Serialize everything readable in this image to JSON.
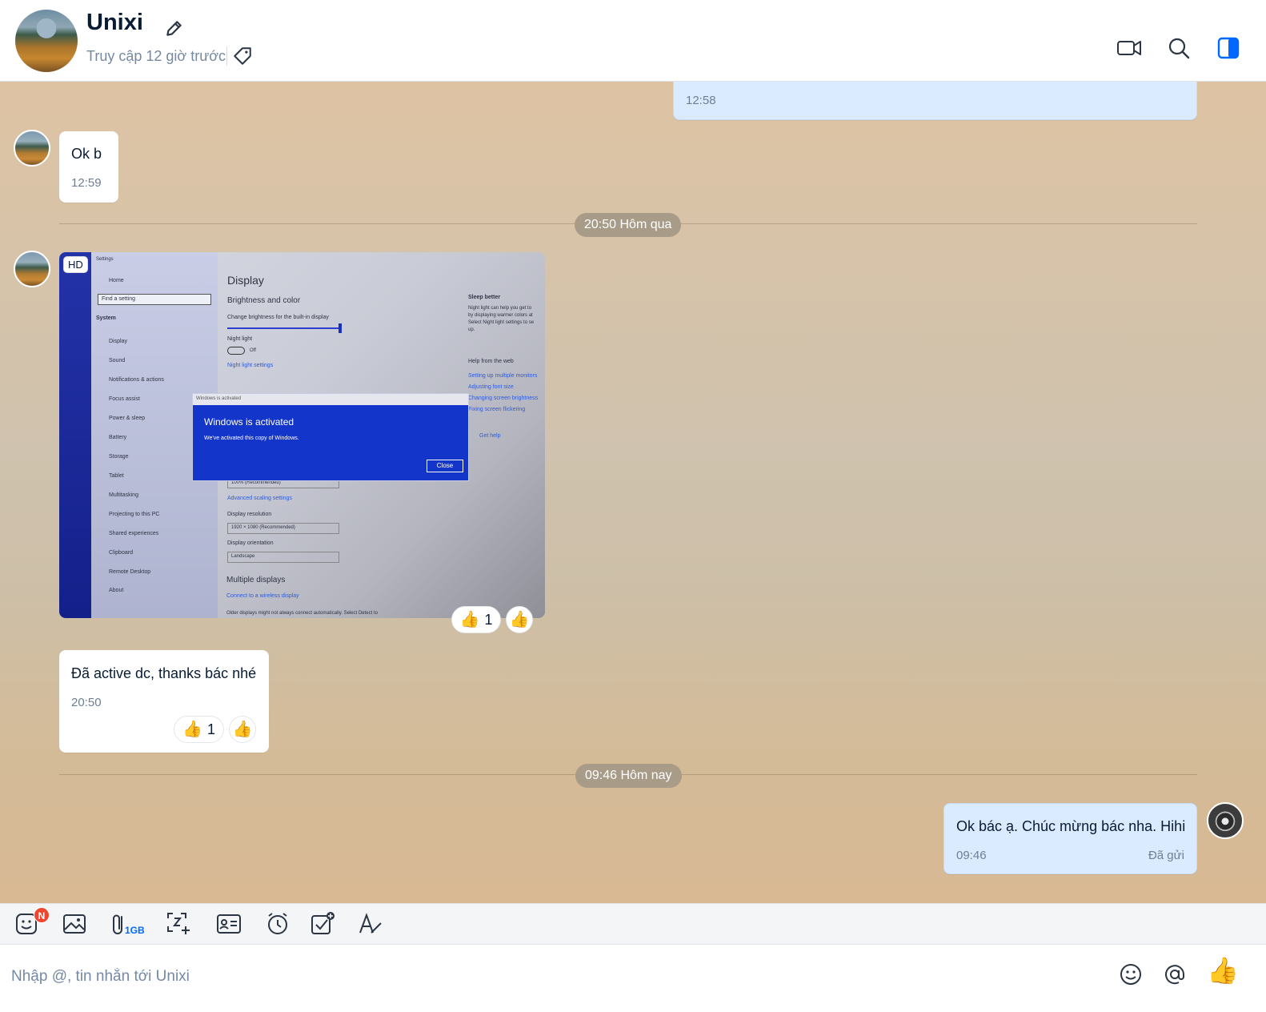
{
  "header": {
    "name": "Unixi",
    "status": "Truy cập 12 giờ trước"
  },
  "messages": {
    "top_partial_time": "12:58",
    "ok_b": {
      "text": "Ok b",
      "time": "12:59"
    },
    "date_divider_1": "20:50 Hôm qua",
    "image": {
      "hd_badge": "HD",
      "screen": {
        "settings": "Settings",
        "home": "Home",
        "find": "Find a setting",
        "system": "System",
        "menu": [
          "Display",
          "Sound",
          "Notifications & actions",
          "Focus assist",
          "Power & sleep",
          "Battery",
          "Storage",
          "Tablet",
          "Multitasking",
          "Projecting to this PC",
          "Shared experiences",
          "Clipboard",
          "Remote Desktop",
          "About"
        ],
        "display_title": "Display",
        "brightness_title": "Brightness and color",
        "brightness_desc": "Change brightness for the built-in display",
        "night_light": "Night light",
        "off": "Off",
        "night_light_settings": "Night light settings",
        "scale_value": "100% (Recommended)",
        "advanced_scaling": "Advanced scaling settings",
        "display_resolution": "Display resolution",
        "resolution_value": "1920 × 1080 (Recommended)",
        "display_orientation": "Display orientation",
        "orientation_value": "Landscape",
        "multiple_displays": "Multiple displays",
        "connect_wireless": "Connect to a wireless display",
        "older_displays": "Older displays might not always connect automatically. Select Detect to",
        "sleep_better": "Sleep better",
        "sleep_desc": "Night light can help you get to",
        "sleep_desc2": "by displaying warmer colors at",
        "sleep_desc3": "Select Night light settings to se",
        "sleep_desc4": "up.",
        "help_web": "Help from the web",
        "help_links": [
          "Setting up multiple monitors",
          "Adjusting font size",
          "Changing screen brightness",
          "Fixing screen flickering"
        ],
        "get_help": "Get help",
        "dialog_titlebar": "Windows is activated",
        "dialog_title": "Windows is activated",
        "dialog_body": "We've activated this copy of Windows.",
        "dialog_close": "Close"
      },
      "reaction_count": "1"
    },
    "active": {
      "text": "Đã active dc, thanks bác nhé",
      "time": "20:50",
      "reaction_count": "1"
    },
    "date_divider_2": "09:46 Hôm nay",
    "me_last": {
      "text": "Ok bác ạ. Chúc mừng bác nha. Hihi",
      "time": "09:46",
      "status": "Đã gửi"
    }
  },
  "toolbar": {
    "sticker_badge": "N",
    "file_limit": "1GB",
    "icons": [
      "sticker-icon",
      "image-icon",
      "attachment-icon",
      "screenshot-icon",
      "contact-card-icon",
      "reminder-clock-icon",
      "todo-icon",
      "text-format-icon"
    ]
  },
  "input": {
    "placeholder": "Nhập @, tin nhắn tới Unixi"
  },
  "colors": {
    "accent": "#0068ff",
    "my_bubble": "#dbebff",
    "badge": "#f0452e"
  }
}
